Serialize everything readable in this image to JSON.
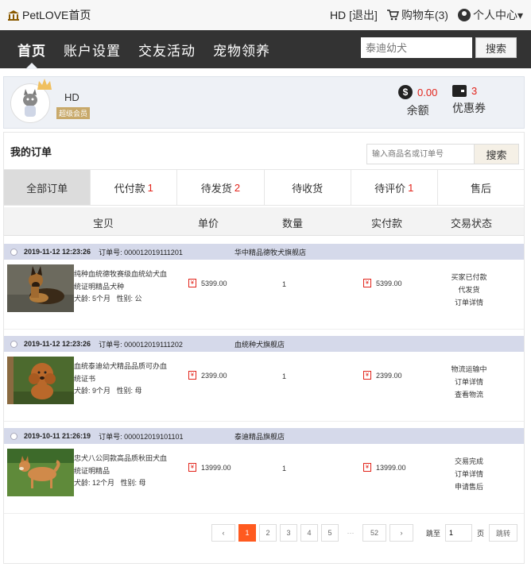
{
  "topbar": {
    "site_name": "PetLOVE首页",
    "username": "HD",
    "logout": "[退出]",
    "cart": "购物车(3)",
    "user_center": "个人中心▾"
  },
  "navbar": {
    "items": [
      "首页",
      "账户设置",
      "交友活动",
      "宠物领养"
    ],
    "search_placeholder": "泰迪幼犬",
    "search_button": "搜索"
  },
  "profile": {
    "name": "HD",
    "badge": "超级会员",
    "balance_value": "0.00",
    "balance_label": "余额",
    "coupon_value": "3",
    "coupon_label": "优惠券"
  },
  "orders": {
    "title": "我的订单",
    "search_placeholder": "输入商品名或订单号",
    "search_button": "搜索",
    "tabs": [
      {
        "label": "全部订单",
        "count": ""
      },
      {
        "label": "代付款",
        "count": "1"
      },
      {
        "label": "待发货",
        "count": "2"
      },
      {
        "label": "待收货",
        "count": ""
      },
      {
        "label": "待评价",
        "count": "1"
      },
      {
        "label": "售后",
        "count": ""
      }
    ],
    "columns": [
      "宝贝",
      "单价",
      "数量",
      "实付款",
      "交易状态"
    ],
    "list": [
      {
        "datetime": "2019-11-12  12:23:26",
        "order_no": "订单号: 000012019111201",
        "shop": "华中精品德牧犬旗舰店",
        "desc": "纯种血统德牧赛级血统幼犬血统证明精品犬种",
        "age": "犬龄:  5个月",
        "gender": "性别:  公",
        "unit_price": "5399.00",
        "qty": "1",
        "paid": "5399.00",
        "status": [
          "买家已付款",
          "代发货",
          "订单详情"
        ]
      },
      {
        "datetime": "2019-11-12  12:23:26",
        "order_no": "订单号: 000012019111202",
        "shop": "血统种犬旗舰店",
        "desc": "血统泰迪幼犬精品品质可办血统证书",
        "age": "犬龄:  9个月",
        "gender": "性别:  母",
        "unit_price": "2399.00",
        "qty": "1",
        "paid": "2399.00",
        "status": [
          "物流运输中",
          "订单详情",
          "查看物流"
        ]
      },
      {
        "datetime": "2019-10-11  21:26:19",
        "order_no": "订单号: 000012019101101",
        "shop": "泰迪精品旗舰店",
        "desc": "忠犬八公同款高品质秋田犬血统证明精品",
        "age": "犬龄:  12个月",
        "gender": "性别:  母",
        "unit_price": "13999.00",
        "qty": "1",
        "paid": "13999.00",
        "status": [
          "交易完成",
          "订单详情",
          "申请售后"
        ]
      }
    ]
  },
  "pager": {
    "prev": "‹",
    "pages": [
      "1",
      "2",
      "3",
      "4",
      "5"
    ],
    "dots": "···",
    "last": "52",
    "next": "›",
    "jump_label": "跳至",
    "jump_value": "1",
    "page_unit": "页",
    "go": "跳转"
  },
  "colors": {
    "nav_bg": "#333333",
    "accent_red": "#e2231a",
    "active_page": "#ff5a1f",
    "order_header": "#d5d9ea"
  }
}
